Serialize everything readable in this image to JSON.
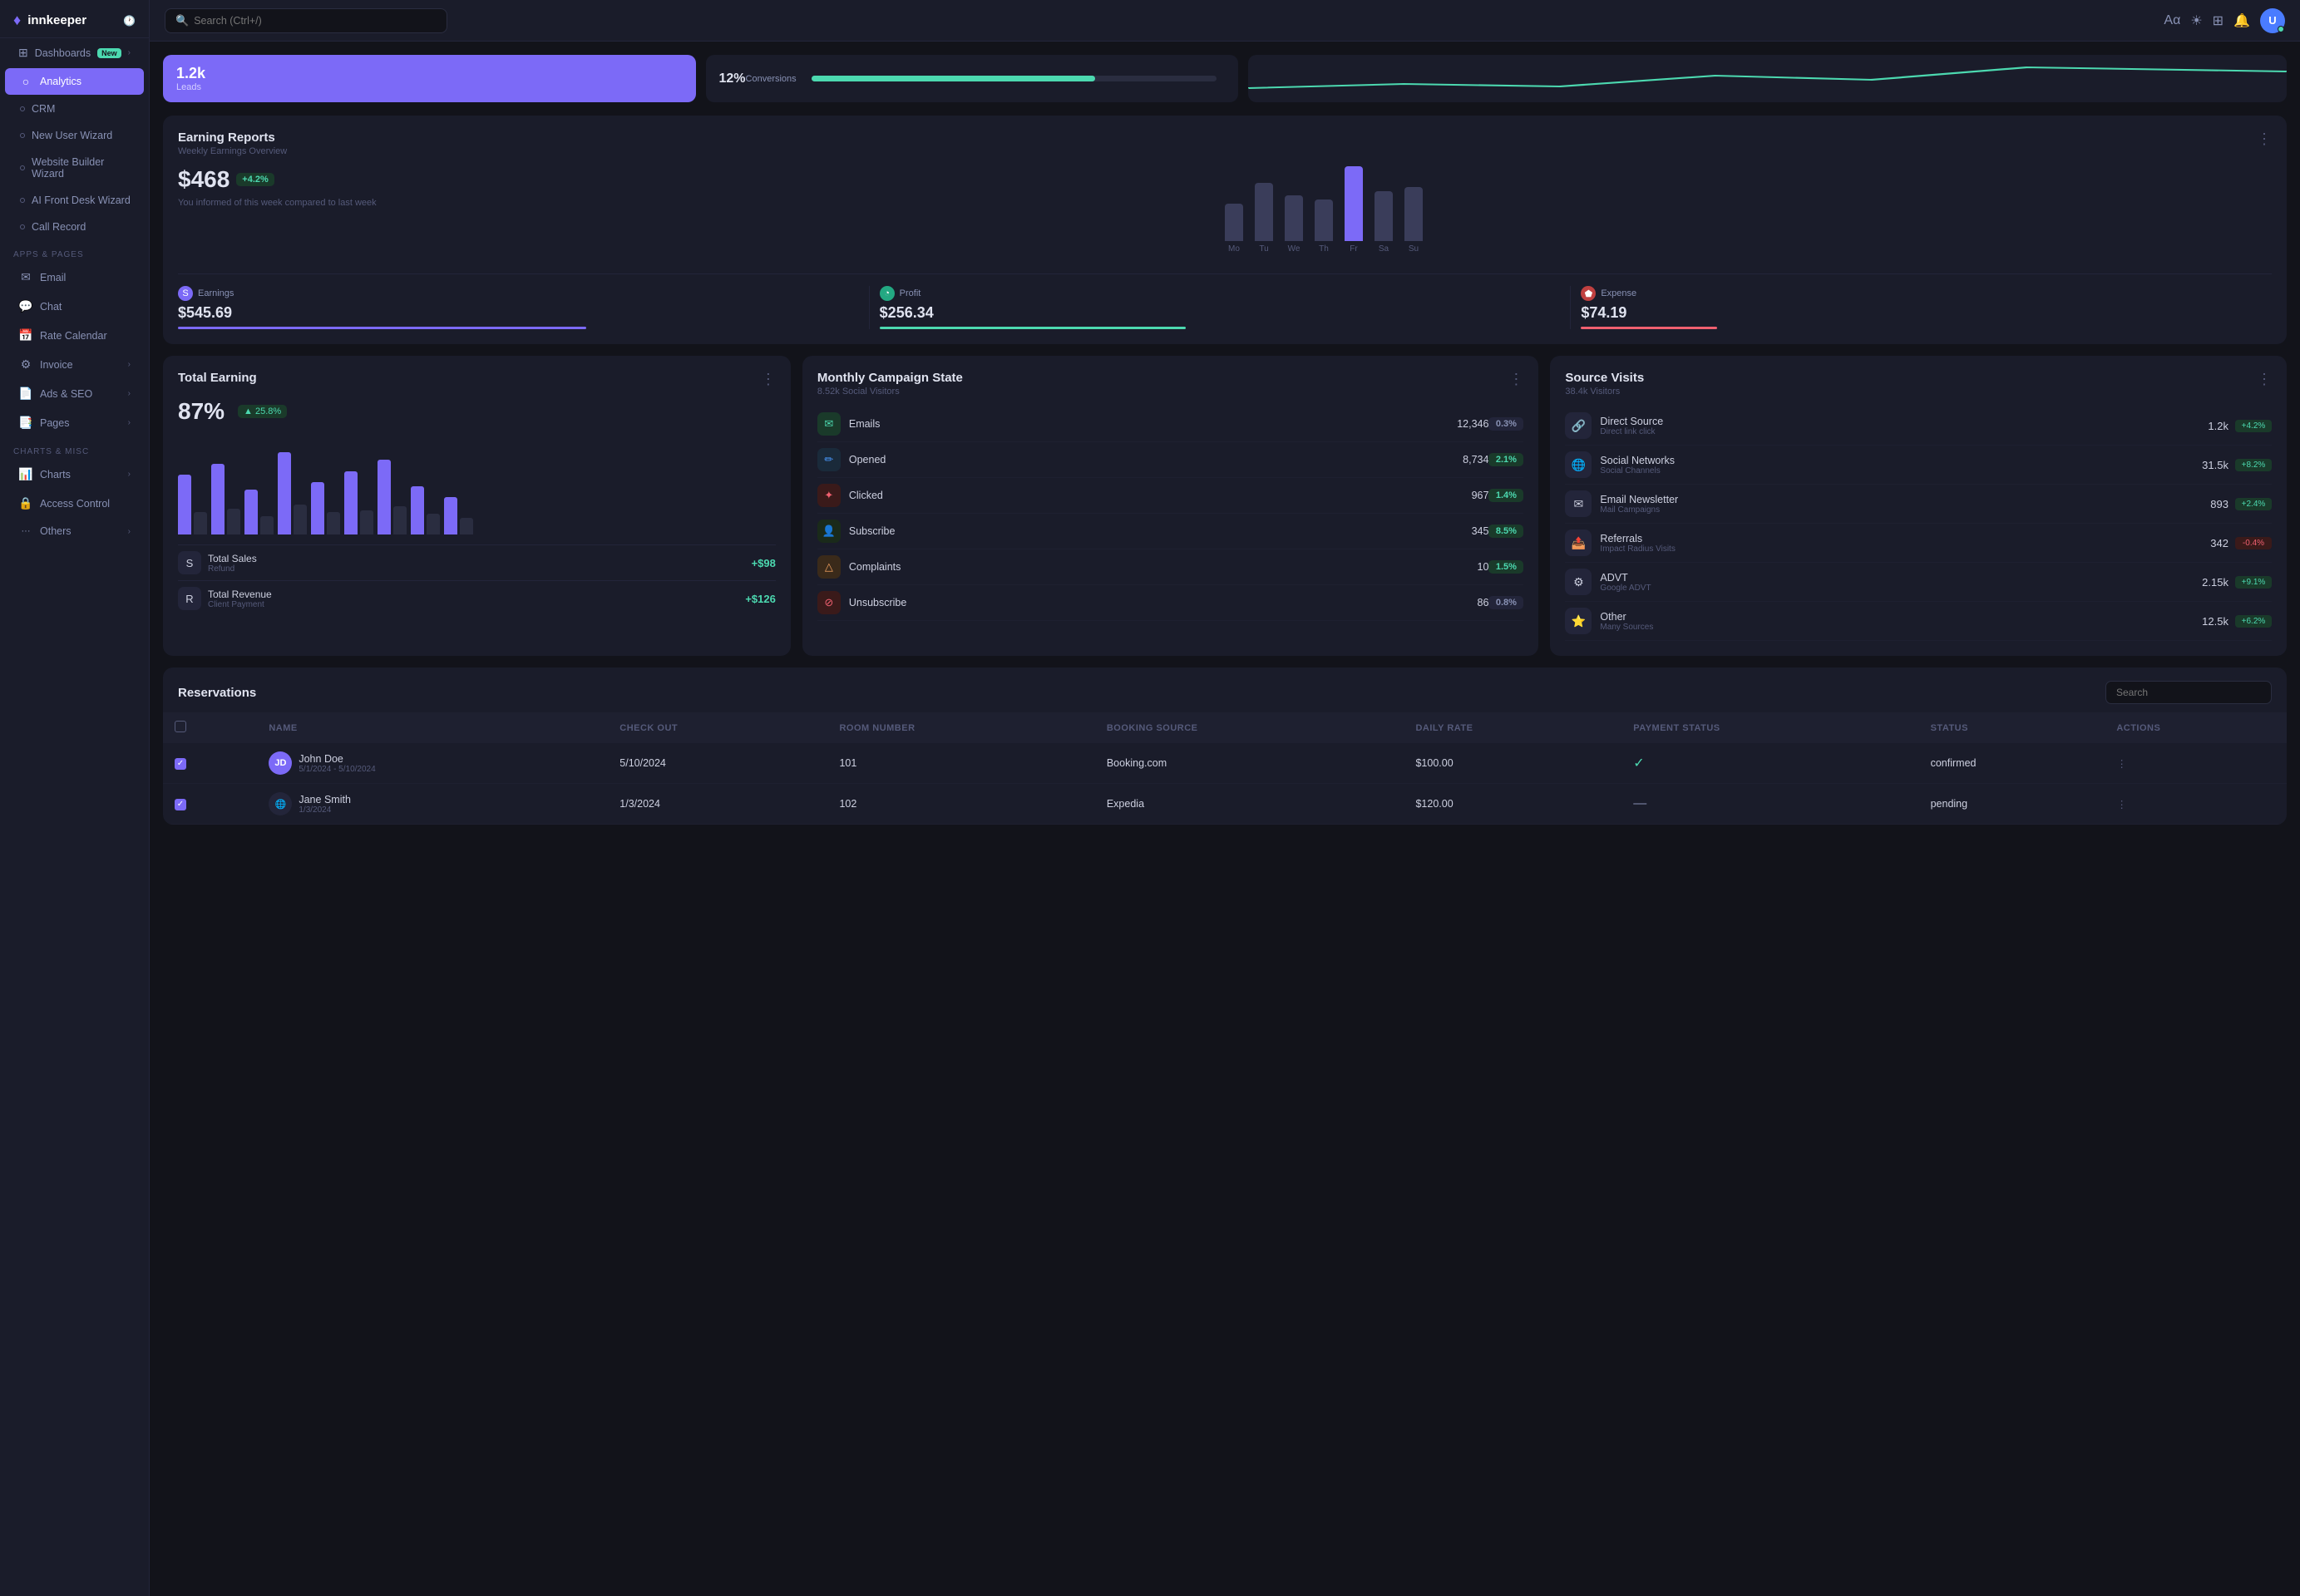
{
  "app": {
    "name": "innkeeper",
    "logo_icon": "♦"
  },
  "topbar": {
    "search_placeholder": "Search (Ctrl+/)"
  },
  "sidebar": {
    "main_items": [
      {
        "id": "dashboards",
        "label": "Dashboards",
        "icon": "⊞",
        "badge": "New",
        "has_chevron": true
      },
      {
        "id": "analytics",
        "label": "Analytics",
        "icon": "○",
        "active": true
      }
    ],
    "wizard_items": [
      {
        "id": "crm",
        "label": "CRM",
        "dot": true
      },
      {
        "id": "new-user-wizard",
        "label": "New User Wizard",
        "dot": true
      },
      {
        "id": "website-builder-wizard",
        "label": "Website Builder Wizard",
        "dot": true
      },
      {
        "id": "ai-front-desk-wizard",
        "label": "AI Front Desk Wizard",
        "dot": true
      },
      {
        "id": "call-record",
        "label": "Call Record",
        "dot": true
      }
    ],
    "apps_label": "APPS & PAGES",
    "apps_items": [
      {
        "id": "email",
        "label": "Email",
        "icon": "✉"
      },
      {
        "id": "chat",
        "label": "Chat",
        "icon": "💬"
      },
      {
        "id": "rate-calendar",
        "label": "Rate Calendar",
        "icon": "📅"
      },
      {
        "id": "invoice",
        "label": "Invoice",
        "icon": "⚙",
        "has_chevron": true
      },
      {
        "id": "ads-seo",
        "label": "Ads & SEO",
        "icon": "📄",
        "has_chevron": true
      },
      {
        "id": "pages",
        "label": "Pages",
        "icon": "📑",
        "has_chevron": true
      }
    ],
    "charts_label": "CHARTS & MISC",
    "charts_items": [
      {
        "id": "charts",
        "label": "Charts",
        "icon": "📊",
        "has_chevron": true
      },
      {
        "id": "access-control",
        "label": "Access Control",
        "icon": "🔒"
      },
      {
        "id": "others",
        "label": "Others",
        "icon": "···",
        "has_chevron": true
      }
    ]
  },
  "earning_reports": {
    "title": "Earning Reports",
    "subtitle": "Weekly Earnings Overview",
    "amount": "$468",
    "badge": "+4.2%",
    "note": "You informed of this week compared to last week",
    "bars": [
      {
        "label": "Mo",
        "height": 45,
        "color": "#3a3d5a"
      },
      {
        "label": "Tu",
        "height": 70,
        "color": "#3a3d5a"
      },
      {
        "label": "We",
        "height": 55,
        "color": "#3a3d5a"
      },
      {
        "label": "Th",
        "height": 50,
        "color": "#3a3d5a"
      },
      {
        "label": "Fr",
        "height": 90,
        "color": "#7c6af7"
      },
      {
        "label": "Sa",
        "height": 60,
        "color": "#3a3d5a"
      },
      {
        "label": "Su",
        "height": 65,
        "color": "#3a3d5a"
      }
    ],
    "financials": [
      {
        "id": "earnings",
        "label": "Earnings",
        "icon": "S",
        "icon_bg": "#7c6af7",
        "value": "$545.69",
        "bar_color": "#7c6af7",
        "bar_pct": 60
      },
      {
        "id": "profit",
        "label": "Profit",
        "icon": "◔",
        "icon_bg": "#23a882",
        "value": "$256.34",
        "bar_color": "#4cd9b0",
        "bar_pct": 45
      },
      {
        "id": "expense",
        "label": "Expense",
        "icon": "⬟",
        "icon_bg": "#c04040",
        "value": "$74.19",
        "bar_color": "#f06070",
        "bar_pct": 20
      }
    ]
  },
  "total_earning": {
    "title": "Total Earning",
    "menu_icon": "⋮",
    "pct": "87%",
    "badge": "▲ 25.8%",
    "bars": [
      {
        "blue": 80,
        "gray": 30
      },
      {
        "blue": 95,
        "gray": 35
      },
      {
        "blue": 60,
        "gray": 25
      },
      {
        "blue": 110,
        "gray": 40
      },
      {
        "blue": 70,
        "gray": 30
      },
      {
        "blue": 85,
        "gray": 32
      },
      {
        "blue": 100,
        "gray": 38
      },
      {
        "blue": 65,
        "gray": 28
      },
      {
        "blue": 50,
        "gray": 22
      }
    ],
    "rows": [
      {
        "id": "total-sales",
        "icon": "S",
        "icon_bg": "#23253a",
        "label": "Total Sales",
        "sublabel": "Refund",
        "value": "+$98"
      },
      {
        "id": "total-revenue",
        "icon": "R",
        "icon_bg": "#23253a",
        "label": "Total Revenue",
        "sublabel": "Client Payment",
        "value": "+$126"
      }
    ]
  },
  "campaign": {
    "title": "Monthly Campaign State",
    "subtitle": "8.52k Social Visitors",
    "menu_icon": "⋮",
    "rows": [
      {
        "id": "emails",
        "label": "Emails",
        "icon": "✉",
        "icon_bg": "#1a3a2a",
        "icon_color": "#4cd9b0",
        "count": "12,346",
        "pct": "0.3%",
        "pct_type": "neutral"
      },
      {
        "id": "opened",
        "label": "Opened",
        "icon": "✏",
        "icon_bg": "#1a2a3a",
        "icon_color": "#4a9aff",
        "count": "8,734",
        "pct": "2.1%",
        "pct_type": "pos"
      },
      {
        "id": "clicked",
        "label": "Clicked",
        "icon": "✦",
        "icon_bg": "#3a1a1a",
        "icon_color": "#f06070",
        "count": "967",
        "pct": "1.4%",
        "pct_type": "pos"
      },
      {
        "id": "subscribe",
        "label": "Subscribe",
        "icon": "👤",
        "icon_bg": "#1a2a1a",
        "icon_color": "#4cd9b0",
        "count": "345",
        "pct": "8.5%",
        "pct_type": "pos"
      },
      {
        "id": "complaints",
        "label": "Complaints",
        "icon": "△",
        "icon_bg": "#3a2a1a",
        "icon_color": "#f0a060",
        "count": "10",
        "pct": "1.5%",
        "pct_type": "pos"
      },
      {
        "id": "unsubscribe",
        "label": "Unsubscribe",
        "icon": "⊘",
        "icon_bg": "#3a1a1a",
        "icon_color": "#f06070",
        "count": "86",
        "pct": "0.8%",
        "pct_type": "neutral"
      }
    ]
  },
  "source_visits": {
    "title": "Source Visits",
    "subtitle": "38.4k Visitors",
    "menu_icon": "⋮",
    "rows": [
      {
        "id": "direct-source",
        "icon": "🔗",
        "name": "Direct Source",
        "sub": "Direct link click",
        "value": "1.2k",
        "badge": "+4.2%",
        "badge_type": "pos"
      },
      {
        "id": "social-networks",
        "icon": "🌐",
        "name": "Social Networks",
        "sub": "Social Channels",
        "value": "31.5k",
        "badge": "+8.2%",
        "badge_type": "pos"
      },
      {
        "id": "email-newsletter",
        "icon": "✉",
        "name": "Email Newsletter",
        "sub": "Mail Campaigns",
        "value": "893",
        "badge": "+2.4%",
        "badge_type": "pos"
      },
      {
        "id": "referrals",
        "icon": "📤",
        "name": "Referrals",
        "sub": "Impact Radius Visits",
        "value": "342",
        "badge": "-0.4%",
        "badge_type": "neg"
      },
      {
        "id": "advt",
        "icon": "⚙",
        "name": "ADVT",
        "sub": "Google ADVT",
        "value": "2.15k",
        "badge": "+9.1%",
        "badge_type": "pos"
      },
      {
        "id": "other",
        "icon": "⭐",
        "name": "Other",
        "sub": "Many Sources",
        "value": "12.5k",
        "badge": "+6.2%",
        "badge_type": "pos"
      }
    ]
  },
  "reservations": {
    "title": "Reservations",
    "search_placeholder": "Search",
    "columns": [
      "",
      "NAME",
      "CHECK OUT",
      "ROOM NUMBER",
      "BOOKING SOURCE",
      "DAILY RATE",
      "PAYMENT STATUS",
      "STATUS",
      "ACTIONS"
    ],
    "rows": [
      {
        "id": "john-doe",
        "checked": true,
        "avatar_initials": "JD",
        "avatar_bg": "#7c6af7",
        "name": "John Doe",
        "date_range": "5/1/2024 - 5/10/2024",
        "checkout": "5/10/2024",
        "room": "101",
        "source": "Booking.com",
        "rate": "$100.00",
        "payment_icon": "✓",
        "payment_color": "#4cd9b0",
        "status": "confirmed",
        "status_color": "#cdd0e0"
      },
      {
        "id": "jane-smith",
        "checked": true,
        "avatar_initials": "🌐",
        "avatar_bg": "#23253a",
        "name": "Jane Smith",
        "date_range": "1/3/2024",
        "checkout": "1/3/2024",
        "room": "102",
        "source": "Expedia",
        "rate": "$120.00",
        "payment_icon": "—",
        "payment_color": "#8891b4",
        "status": "pending",
        "status_color": "#cdd0e0"
      }
    ]
  },
  "top_stats": {
    "leads": {
      "value": "1.2k",
      "label": "Leads"
    },
    "conversions": {
      "value": "12%",
      "label": "Conversions"
    },
    "progress_color": "#4cd9b0",
    "progress_pct": 70
  }
}
